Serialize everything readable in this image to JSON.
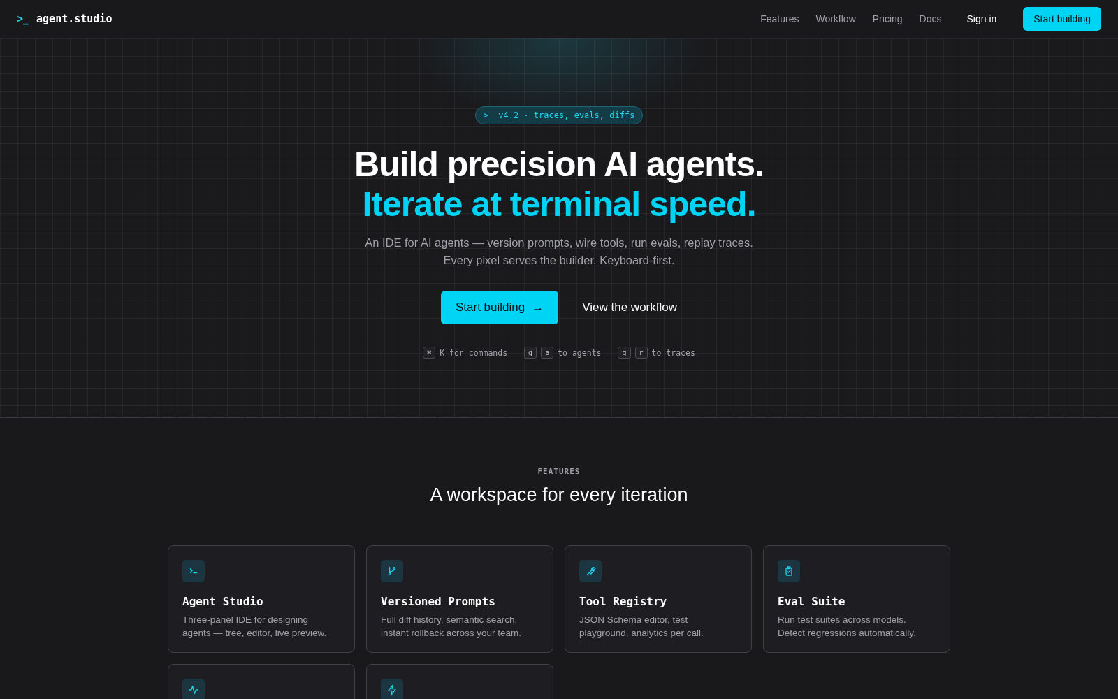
{
  "nav": {
    "logo_prompt": ">_",
    "logo": "agent.studio",
    "links": [
      "Features",
      "Workflow",
      "Pricing",
      "Docs"
    ],
    "sign_in": "Sign in",
    "cta": "Start building"
  },
  "hero": {
    "badge": ">_ v4.2 · traces, evals, diffs",
    "title": "Build precision AI agents.",
    "title_accent": "Iterate at terminal speed.",
    "subtitle": [
      "An IDE for AI agents — version prompts, wire tools, run evals, replay traces.",
      "Every pixel serves the builder. Keyboard-first."
    ],
    "primary": {
      "label": "Start building",
      "arrow": "→"
    },
    "secondary": "View the workflow",
    "shortcuts": [
      {
        "keys": [
          "⌘"
        ],
        "text": "K for commands"
      },
      {
        "keys": [
          "g",
          "a"
        ],
        "text": "to agents"
      },
      {
        "keys": [
          "g",
          "r"
        ],
        "text": "to traces"
      }
    ]
  },
  "features": {
    "eyebrow": "FEATURES",
    "heading": "A workspace for every iteration",
    "cards": [
      {
        "kind": "full",
        "title": "Agent Studio",
        "description": "Three-panel IDE for designing agents — tree, editor, live preview."
      },
      {
        "kind": "full",
        "title": "Versioned Prompts",
        "description": "Full diff history, semantic search, instant rollback across your team."
      },
      {
        "kind": "full",
        "title": "Tool Registry",
        "description": "JSON Schema editor, test playground, analytics per call."
      },
      {
        "kind": "full",
        "title": "Eval Suite",
        "description": "Run test suites across models. Detect regressions automatically."
      },
      {
        "kind": "cut_off"
      },
      {
        "kind": "cut_off"
      }
    ]
  }
}
